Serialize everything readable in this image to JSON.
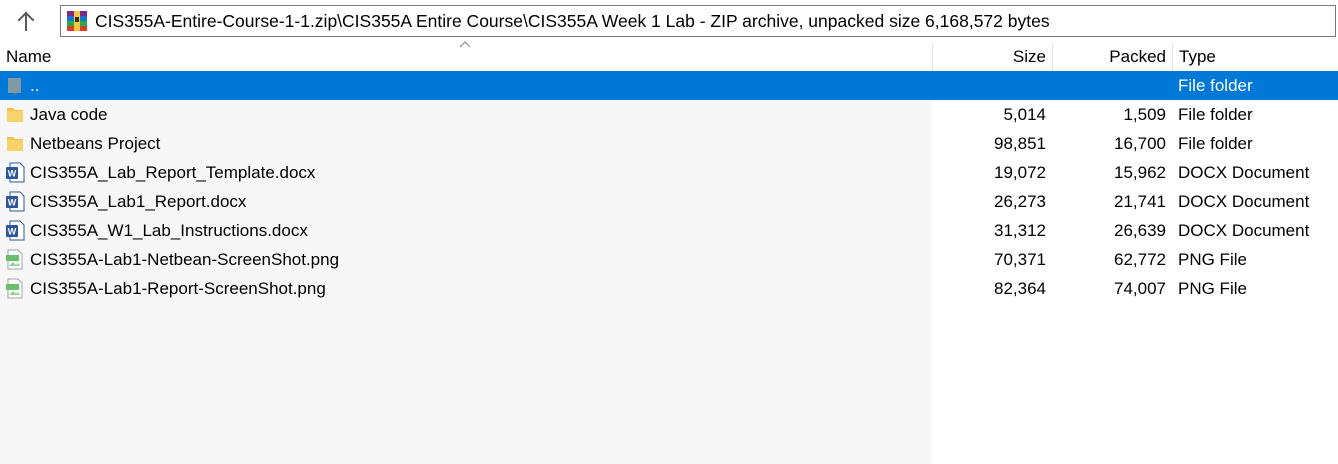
{
  "toolbar": {
    "up_icon": "arrow-up-icon",
    "archive_icon": "winrar-archive-icon",
    "path": "CIS355A-Entire-Course-1-1.zip\\CIS355A Entire Course\\CIS355A Week 1 Lab - ZIP archive, unpacked size 6,168,572 bytes"
  },
  "columns": {
    "name": "Name",
    "size": "Size",
    "packed": "Packed",
    "type": "Type"
  },
  "colors": {
    "selection": "#0078d7",
    "folder": "#f2c14e",
    "word": "#2b579a"
  },
  "files": [
    {
      "name": "..",
      "size": "",
      "packed": "",
      "type": "File folder",
      "icon": "parent-folder-icon",
      "selected": true
    },
    {
      "name": "Java code",
      "size": "5,014",
      "packed": "1,509",
      "type": "File folder",
      "icon": "folder-icon"
    },
    {
      "name": "Netbeans Project",
      "size": "98,851",
      "packed": "16,700",
      "type": "File folder",
      "icon": "folder-icon"
    },
    {
      "name": "CIS355A_Lab_Report_Template.docx",
      "size": "19,072",
      "packed": "15,962",
      "type": "DOCX Document",
      "icon": "word-document-icon"
    },
    {
      "name": "CIS355A_Lab1_Report.docx",
      "size": "26,273",
      "packed": "21,741",
      "type": "DOCX Document",
      "icon": "word-document-icon"
    },
    {
      "name": "CIS355A_W1_Lab_Instructions.docx",
      "size": "31,312",
      "packed": "26,639",
      "type": "DOCX Document",
      "icon": "word-document-icon"
    },
    {
      "name": "CIS355A-Lab1-Netbean-ScreenShot.png",
      "size": "70,371",
      "packed": "62,772",
      "type": "PNG File",
      "icon": "png-image-icon"
    },
    {
      "name": "CIS355A-Lab1-Report-ScreenShot.png",
      "size": "82,364",
      "packed": "74,007",
      "type": "PNG File",
      "icon": "png-image-icon"
    }
  ]
}
